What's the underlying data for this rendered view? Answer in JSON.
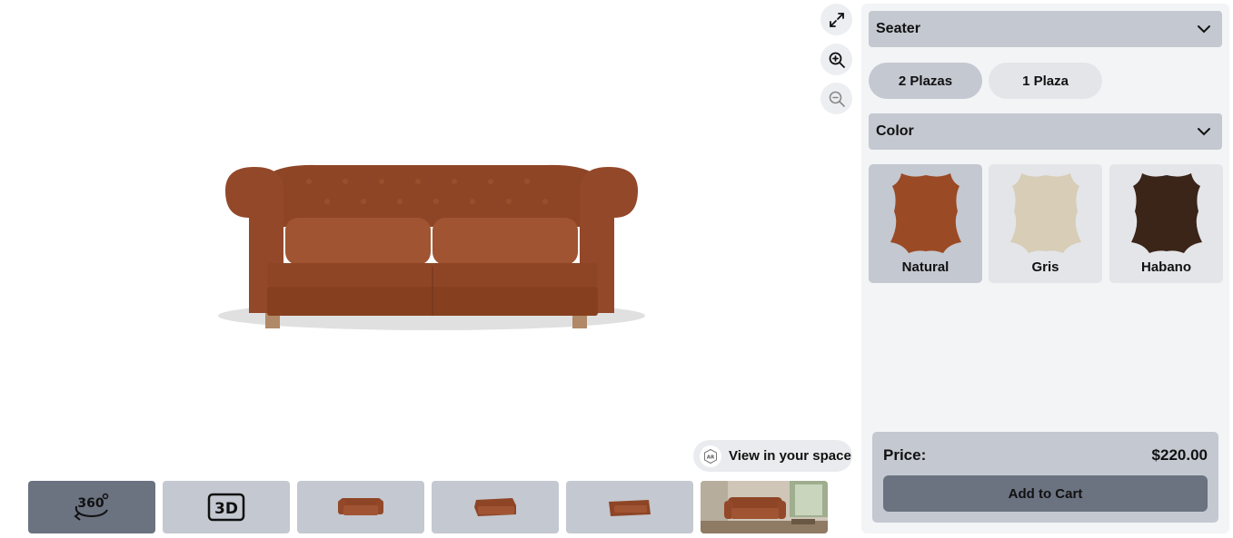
{
  "viewer": {
    "controls": [
      "fullscreen-icon",
      "zoom-in-icon",
      "zoom-out-icon"
    ],
    "ar_button": {
      "icon_text": "AR",
      "label": "View in your space"
    },
    "thumbnails": [
      {
        "type": "360",
        "label": "360"
      },
      {
        "type": "3d",
        "label": "3D"
      },
      {
        "type": "front-view"
      },
      {
        "type": "angle-view"
      },
      {
        "type": "side-view"
      },
      {
        "type": "room-photo"
      }
    ]
  },
  "configurator": {
    "seater": {
      "label": "Seater",
      "options": [
        "2 Plazas",
        "1 Plaza"
      ],
      "selected": "2 Plazas"
    },
    "color": {
      "label": "Color",
      "options": [
        {
          "name": "Natural",
          "hex": "#9a4a24"
        },
        {
          "name": "Gris",
          "hex": "#d8cdb6"
        },
        {
          "name": "Habano",
          "hex": "#3b2418"
        }
      ],
      "selected": "Natural"
    },
    "price_label": "Price:",
    "price_value": "$220.00",
    "add_to_cart": "Add to Cart"
  },
  "colors": {
    "panel": "#c4c8d0",
    "active": "#6b7280",
    "leather": "#9a4a24"
  }
}
